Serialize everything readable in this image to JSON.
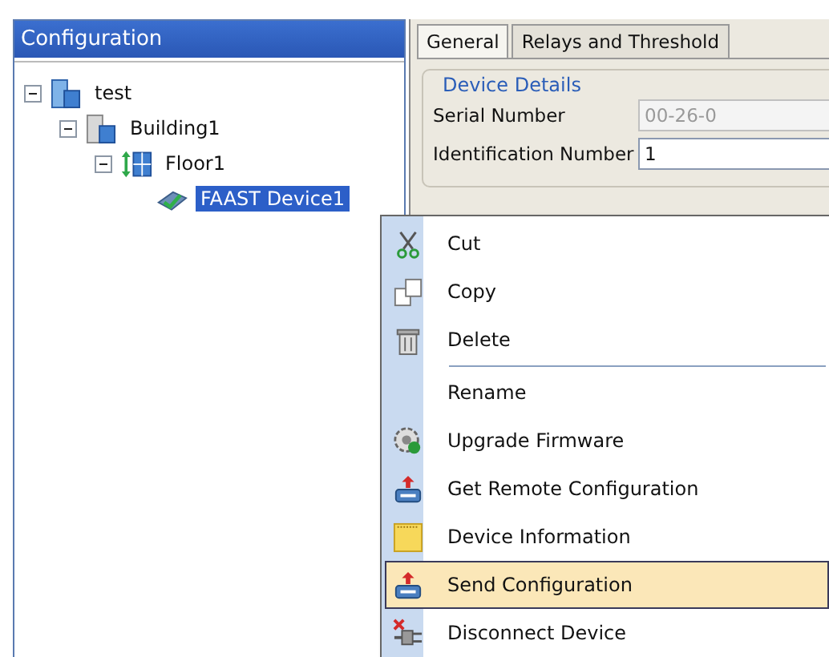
{
  "config_panel": {
    "title": "Configuration"
  },
  "tree": [
    {
      "label": "test",
      "kind": "site",
      "expanded": true,
      "selected": false,
      "children": [
        {
          "label": "Building1",
          "kind": "building",
          "expanded": true,
          "selected": false,
          "children": [
            {
              "label": "Floor1",
              "kind": "floor",
              "expanded": true,
              "selected": false,
              "children": [
                {
                  "label": "FAAST Device1",
                  "kind": "device",
                  "selected": true
                }
              ]
            }
          ]
        }
      ]
    }
  ],
  "tabs": [
    {
      "label": "General",
      "selected": true
    },
    {
      "label": "Relays and Threshold",
      "selected": false
    }
  ],
  "device_details": {
    "title": "Device Details",
    "fields": [
      {
        "label": "Serial Number",
        "value": "00-26-0",
        "disabled": true
      },
      {
        "label": "Identification Number",
        "value": "1",
        "disabled": false
      }
    ]
  },
  "context_menu": [
    {
      "label": "Cut",
      "kind": "cut",
      "selected": false,
      "separator_before": false
    },
    {
      "label": "Copy",
      "kind": "copy",
      "selected": false,
      "separator_before": false
    },
    {
      "label": "Delete",
      "kind": "delete",
      "selected": false,
      "separator_before": false
    },
    {
      "label": "Rename",
      "kind": "plain",
      "selected": false,
      "separator_before": true
    },
    {
      "label": "Upgrade Firmware",
      "kind": "firmware",
      "selected": false,
      "separator_before": false
    },
    {
      "label": "Get Remote Configuration",
      "kind": "transfer",
      "selected": false,
      "separator_before": false
    },
    {
      "label": "Device Information",
      "kind": "info",
      "selected": false,
      "separator_before": false
    },
    {
      "label": "Send Configuration",
      "kind": "transfer",
      "selected": true,
      "separator_before": false
    },
    {
      "label": "Disconnect Device",
      "kind": "disconnect",
      "selected": false,
      "separator_before": false
    }
  ]
}
